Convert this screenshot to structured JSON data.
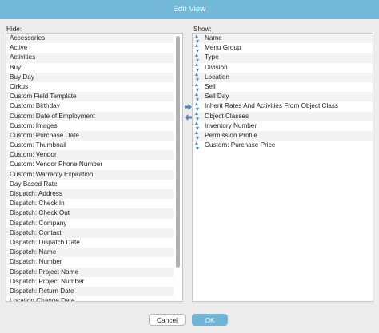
{
  "window": {
    "title": "Edit View"
  },
  "hide": {
    "label": "Hide:",
    "items": [
      "Accessories",
      "Active",
      "Activities",
      "Buy",
      "Buy Day",
      "Cirkus",
      "Custom Field Template",
      "Custom: Birthday",
      "Custom: Date of Employment",
      "Custom: Images",
      "Custom: Purchase Date",
      "Custom: Thumbnail",
      "Custom: Vendor",
      "Custom: Vendor Phone Number",
      "Custom: Warranty Expiration",
      "Day Based Rate",
      "Dispatch: Address",
      "Dispatch: Check In",
      "Dispatch: Check Out",
      "Dispatch: Company",
      "Dispatch: Contact",
      "Dispatch: Dispatch Date",
      "Dispatch: Name",
      "Dispatch: Number",
      "Dispatch: Project Name",
      "Dispatch: Project Number",
      "Dispatch: Return Date",
      "Location Change Date"
    ]
  },
  "show": {
    "label": "Show:",
    "items": [
      "Name",
      "Menu Group",
      "Type",
      "Division",
      "Location",
      "Sell",
      "Sell Day",
      "Inherit Rates And Activities From Object Class",
      "Object Classes",
      "Inventory Number",
      "Permission Profile",
      "Custom: Purchase Price"
    ]
  },
  "actions": {
    "cancel_label": "Cancel",
    "ok_label": "OK"
  },
  "icons": {
    "move_right": "arrow-right-icon",
    "move_left": "arrow-left-icon",
    "drag": "drag-handle-icon"
  },
  "colors": {
    "titlebar": "#74b9d8",
    "ok_button": "#6fb5d8",
    "arrow": "#5584b0"
  }
}
